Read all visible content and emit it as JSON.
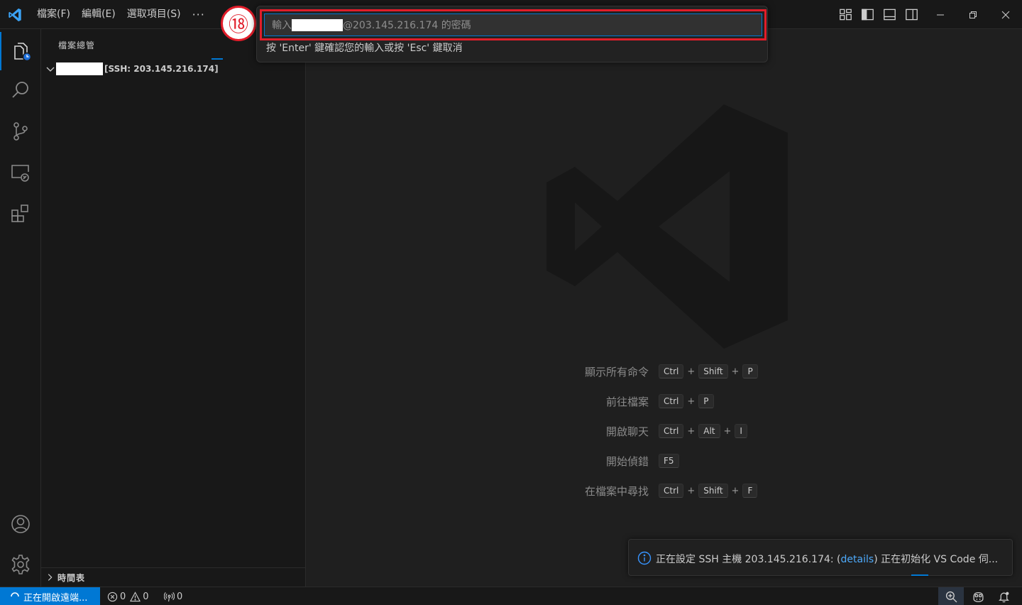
{
  "titlebar": {
    "menu": [
      "檔案(F)",
      "編輯(E)",
      "選取項目(S)"
    ],
    "more": "···"
  },
  "sidebar": {
    "title": "檔案總管",
    "folder_label": "[SSH: 203.145.216.174]",
    "timeline_label": "時間表"
  },
  "quick_input": {
    "placeholder_prefix": "輸入",
    "placeholder_suffix": "@203.145.216.174 的密碼",
    "message": "按 'Enter' 鍵確認您的輸入或按 'Esc' 鍵取消"
  },
  "step_badge": "⑱",
  "shortcuts": [
    {
      "label": "顯示所有命令",
      "keys": [
        "Ctrl",
        "Shift",
        "P"
      ]
    },
    {
      "label": "前往檔案",
      "keys": [
        "Ctrl",
        "P"
      ]
    },
    {
      "label": "開啟聊天",
      "keys": [
        "Ctrl",
        "Alt",
        "I"
      ]
    },
    {
      "label": "開始偵錯",
      "keys": [
        "F5"
      ]
    },
    {
      "label": "在檔案中尋找",
      "keys": [
        "Ctrl",
        "Shift",
        "F"
      ]
    }
  ],
  "notification": {
    "text_before": "正在設定 SSH 主機 203.145.216.174: (",
    "link": "details",
    "text_after": ") 正在初始化 VS Code 伺..."
  },
  "statusbar": {
    "remote": "正在開啟遠端...",
    "errors": "0",
    "warnings": "0",
    "ports": "0"
  },
  "colors": {
    "accent": "#0078d4",
    "highlight": "#e11d2a",
    "link": "#4daafc"
  }
}
